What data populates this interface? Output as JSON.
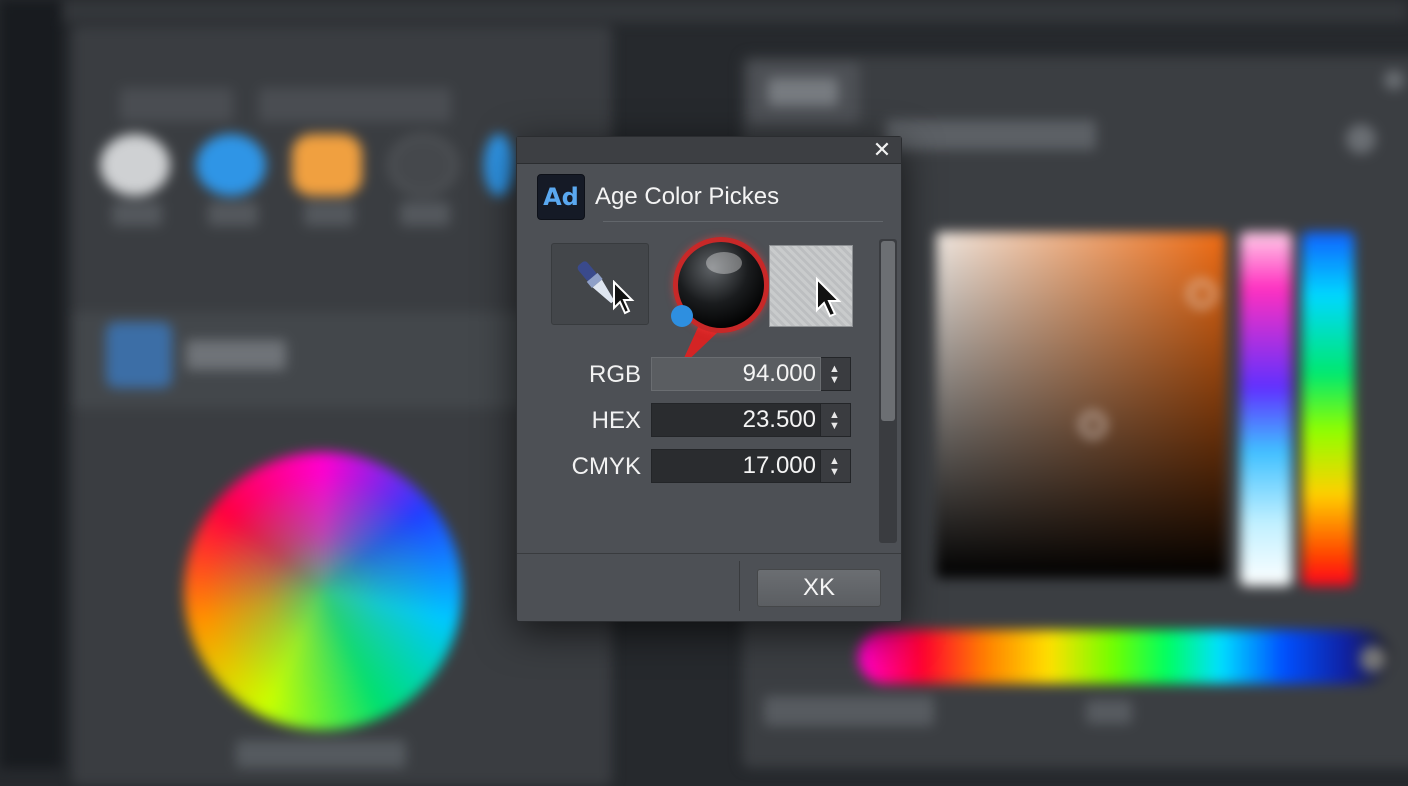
{
  "dialog": {
    "close_glyph": "✕",
    "app_logo_text": "Ad",
    "title": "Age Color Pickes",
    "ok_label": "XK"
  },
  "fields": [
    {
      "label": "RGB",
      "value": "94.000"
    },
    {
      "label": "HEX",
      "value": "23.500"
    },
    {
      "label": "CMYK",
      "value": "17.000"
    }
  ],
  "icons": {
    "eyedropper": "eyedropper-icon",
    "cursor": "cursor-icon",
    "loupe": "magnifier-loupe-icon",
    "stepper": "stepper-arrows-icon",
    "close": "close-icon"
  },
  "colors": {
    "dialog_bg": "#4d5055",
    "titlebar_bg": "#3d3f43",
    "loupe_ring": "#c82828",
    "logo_text": "#5aa8f0",
    "logo_bg": "#151a26"
  }
}
